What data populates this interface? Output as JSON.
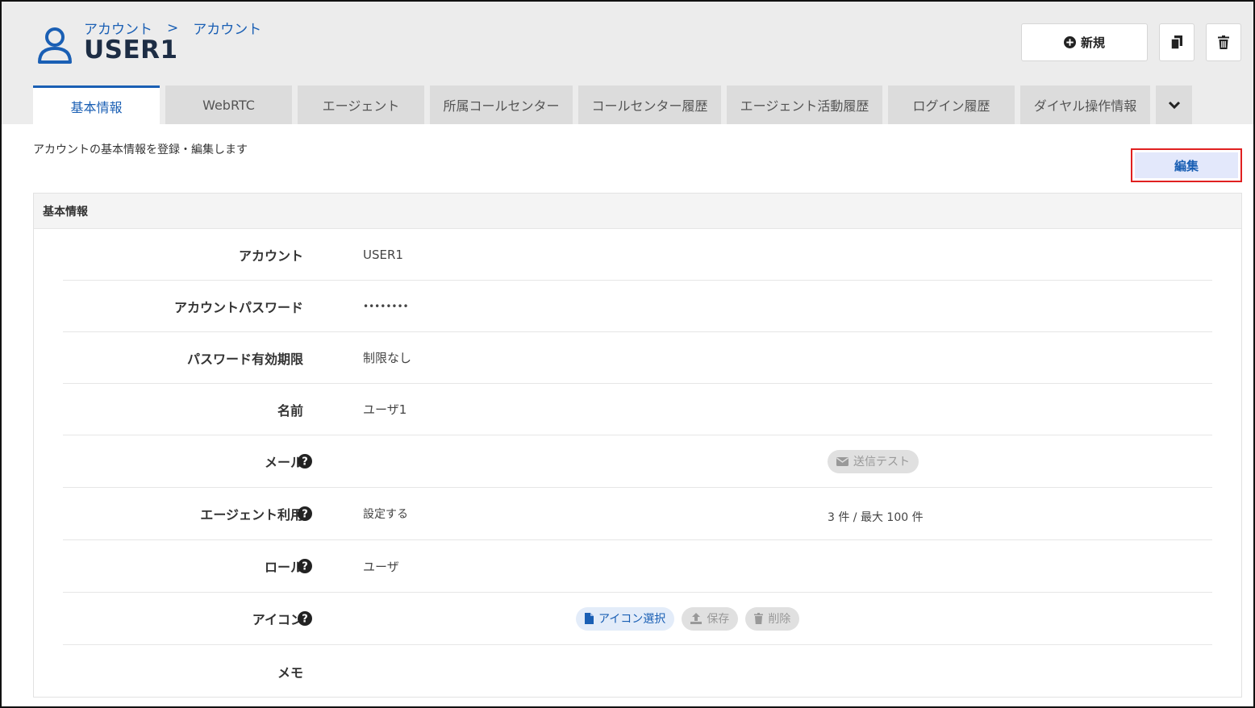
{
  "breadcrumb": {
    "items": [
      "アカウント",
      "アカウント"
    ],
    "separator": ">"
  },
  "page": {
    "title": "USER1"
  },
  "toolbar": {
    "new_label": "新規"
  },
  "tabs": [
    {
      "label": "基本情報",
      "active": true
    },
    {
      "label": "WebRTC",
      "active": false
    },
    {
      "label": "エージェント",
      "active": false
    },
    {
      "label": "所属コールセンター",
      "active": false
    },
    {
      "label": "コールセンター履歴",
      "active": false
    },
    {
      "label": "エージェント活動履歴",
      "active": false
    },
    {
      "label": "ログイン履歴",
      "active": false
    },
    {
      "label": "ダイヤル操作情報",
      "active": false
    }
  ],
  "description": "アカウントの基本情報を登録・編集します",
  "edit_label": "編集",
  "panel": {
    "title": "基本情報",
    "rows": {
      "account": {
        "label": "アカウント",
        "value": "USER1"
      },
      "password": {
        "label": "アカウントパスワード",
        "value": "••••••••"
      },
      "expiry": {
        "label": "パスワード有効期限",
        "value": "制限なし"
      },
      "name": {
        "label": "名前",
        "value": "ユーザ1"
      },
      "mail": {
        "label": "メール",
        "value": "",
        "test_button": "送信テスト"
      },
      "agent": {
        "label": "エージェント利用",
        "value": "設定する",
        "count": "3 件 / 最大 100 件"
      },
      "role": {
        "label": "ロール",
        "value": "ユーザ"
      },
      "icon": {
        "label": "アイコン",
        "select_button": "アイコン選択",
        "save_button": "保存",
        "delete_button": "削除"
      },
      "memo": {
        "label": "メモ",
        "value": ""
      }
    }
  },
  "colors": {
    "accent": "#1a5fb4",
    "header_bg": "#ececec",
    "highlight_border": "#e02020",
    "edit_bg": "#e3e8fb"
  }
}
